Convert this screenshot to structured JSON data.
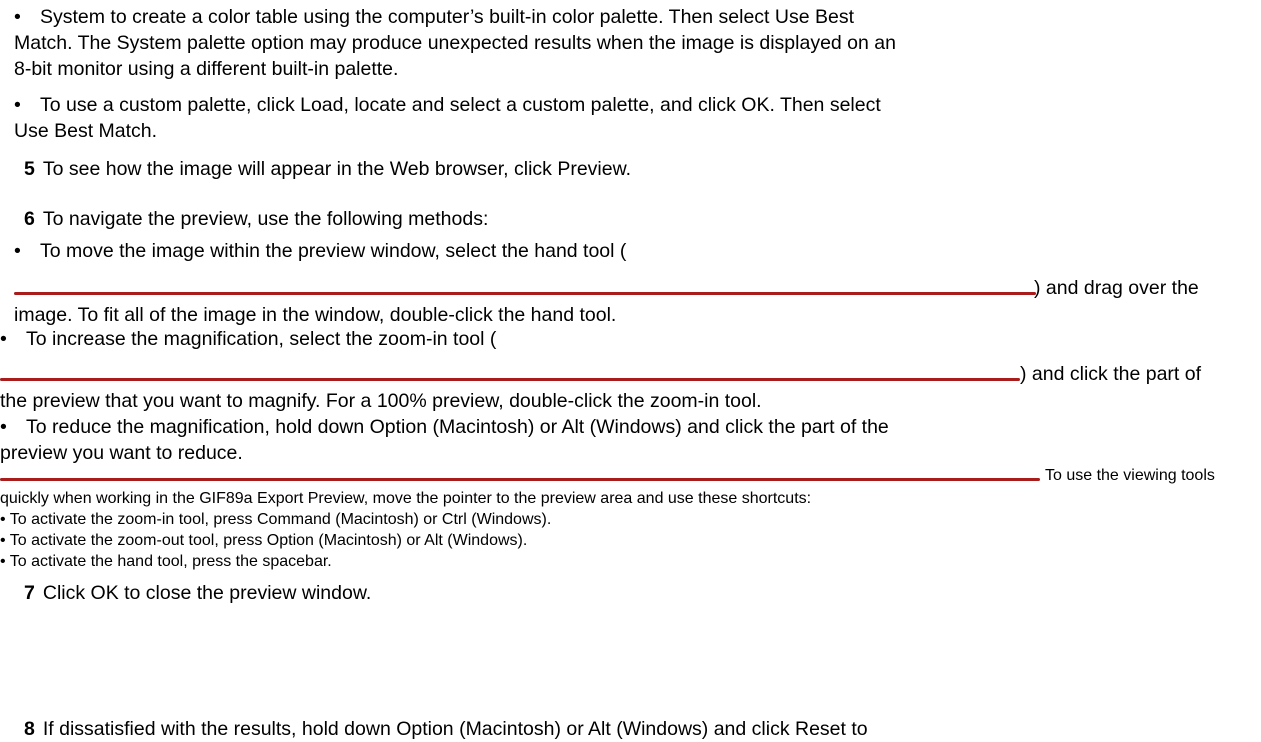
{
  "paragraphs": {
    "bullet_system_1": "System to create a color table using the computer’s built-in color palette. Then select Use Best",
    "bullet_system_2": "Match. The System palette option may produce unexpected results when the image is displayed on an",
    "bullet_system_3": "8-bit monitor using a different built-in palette.",
    "bullet_custom_1": "To use a custom palette, click Load, locate and select a custom palette, and click OK. Then select",
    "bullet_custom_2": "Use Best Match.",
    "step5_num": "5",
    "step5_text": "To see how the image will appear in the Web browser, click Preview.",
    "step6_num": "6",
    "step6_text": "To navigate the preview, use the following methods:",
    "bullet_hand_1": "To move the image within the preview window, select the hand tool (",
    "bullet_hand_2": ") and drag over the",
    "bullet_hand_3": "image. To fit all of the image in the window, double-click the hand tool.",
    "bullet_zoom_1": "To increase the magnification, select the zoom-in tool (",
    "bullet_zoom_2": ") and click the part of",
    "bullet_zoom_3": "the preview that you want to magnify. For a 100% preview, double-click the zoom-in tool.",
    "bullet_reduce_1": "To reduce the magnification, hold down Option (Macintosh) or Alt (Windows) and click the part of the",
    "bullet_reduce_2": "preview you want to reduce.",
    "tip_1": "To use the viewing tools",
    "tip_2": "quickly when working in the GIF89a Export Preview, move the pointer to the preview area and use these shortcuts:",
    "tip_3": "• To activate the zoom-in tool, press Command (Macintosh) or Ctrl (Windows).",
    "tip_4": "• To activate the zoom-out tool, press Option (Macintosh) or Alt (Windows).",
    "tip_5": "• To activate the hand tool, press the spacebar.",
    "step7_num": "7",
    "step7_text": "Click OK to close the preview window.",
    "step8_num": "8",
    "step8_text": "If dissatisfied with the results, hold down Option (Macintosh) or Alt (Windows) and click Reset to"
  },
  "bullet_char": "•",
  "colors": {
    "rule": "#a81c1c",
    "text": "#000000"
  }
}
